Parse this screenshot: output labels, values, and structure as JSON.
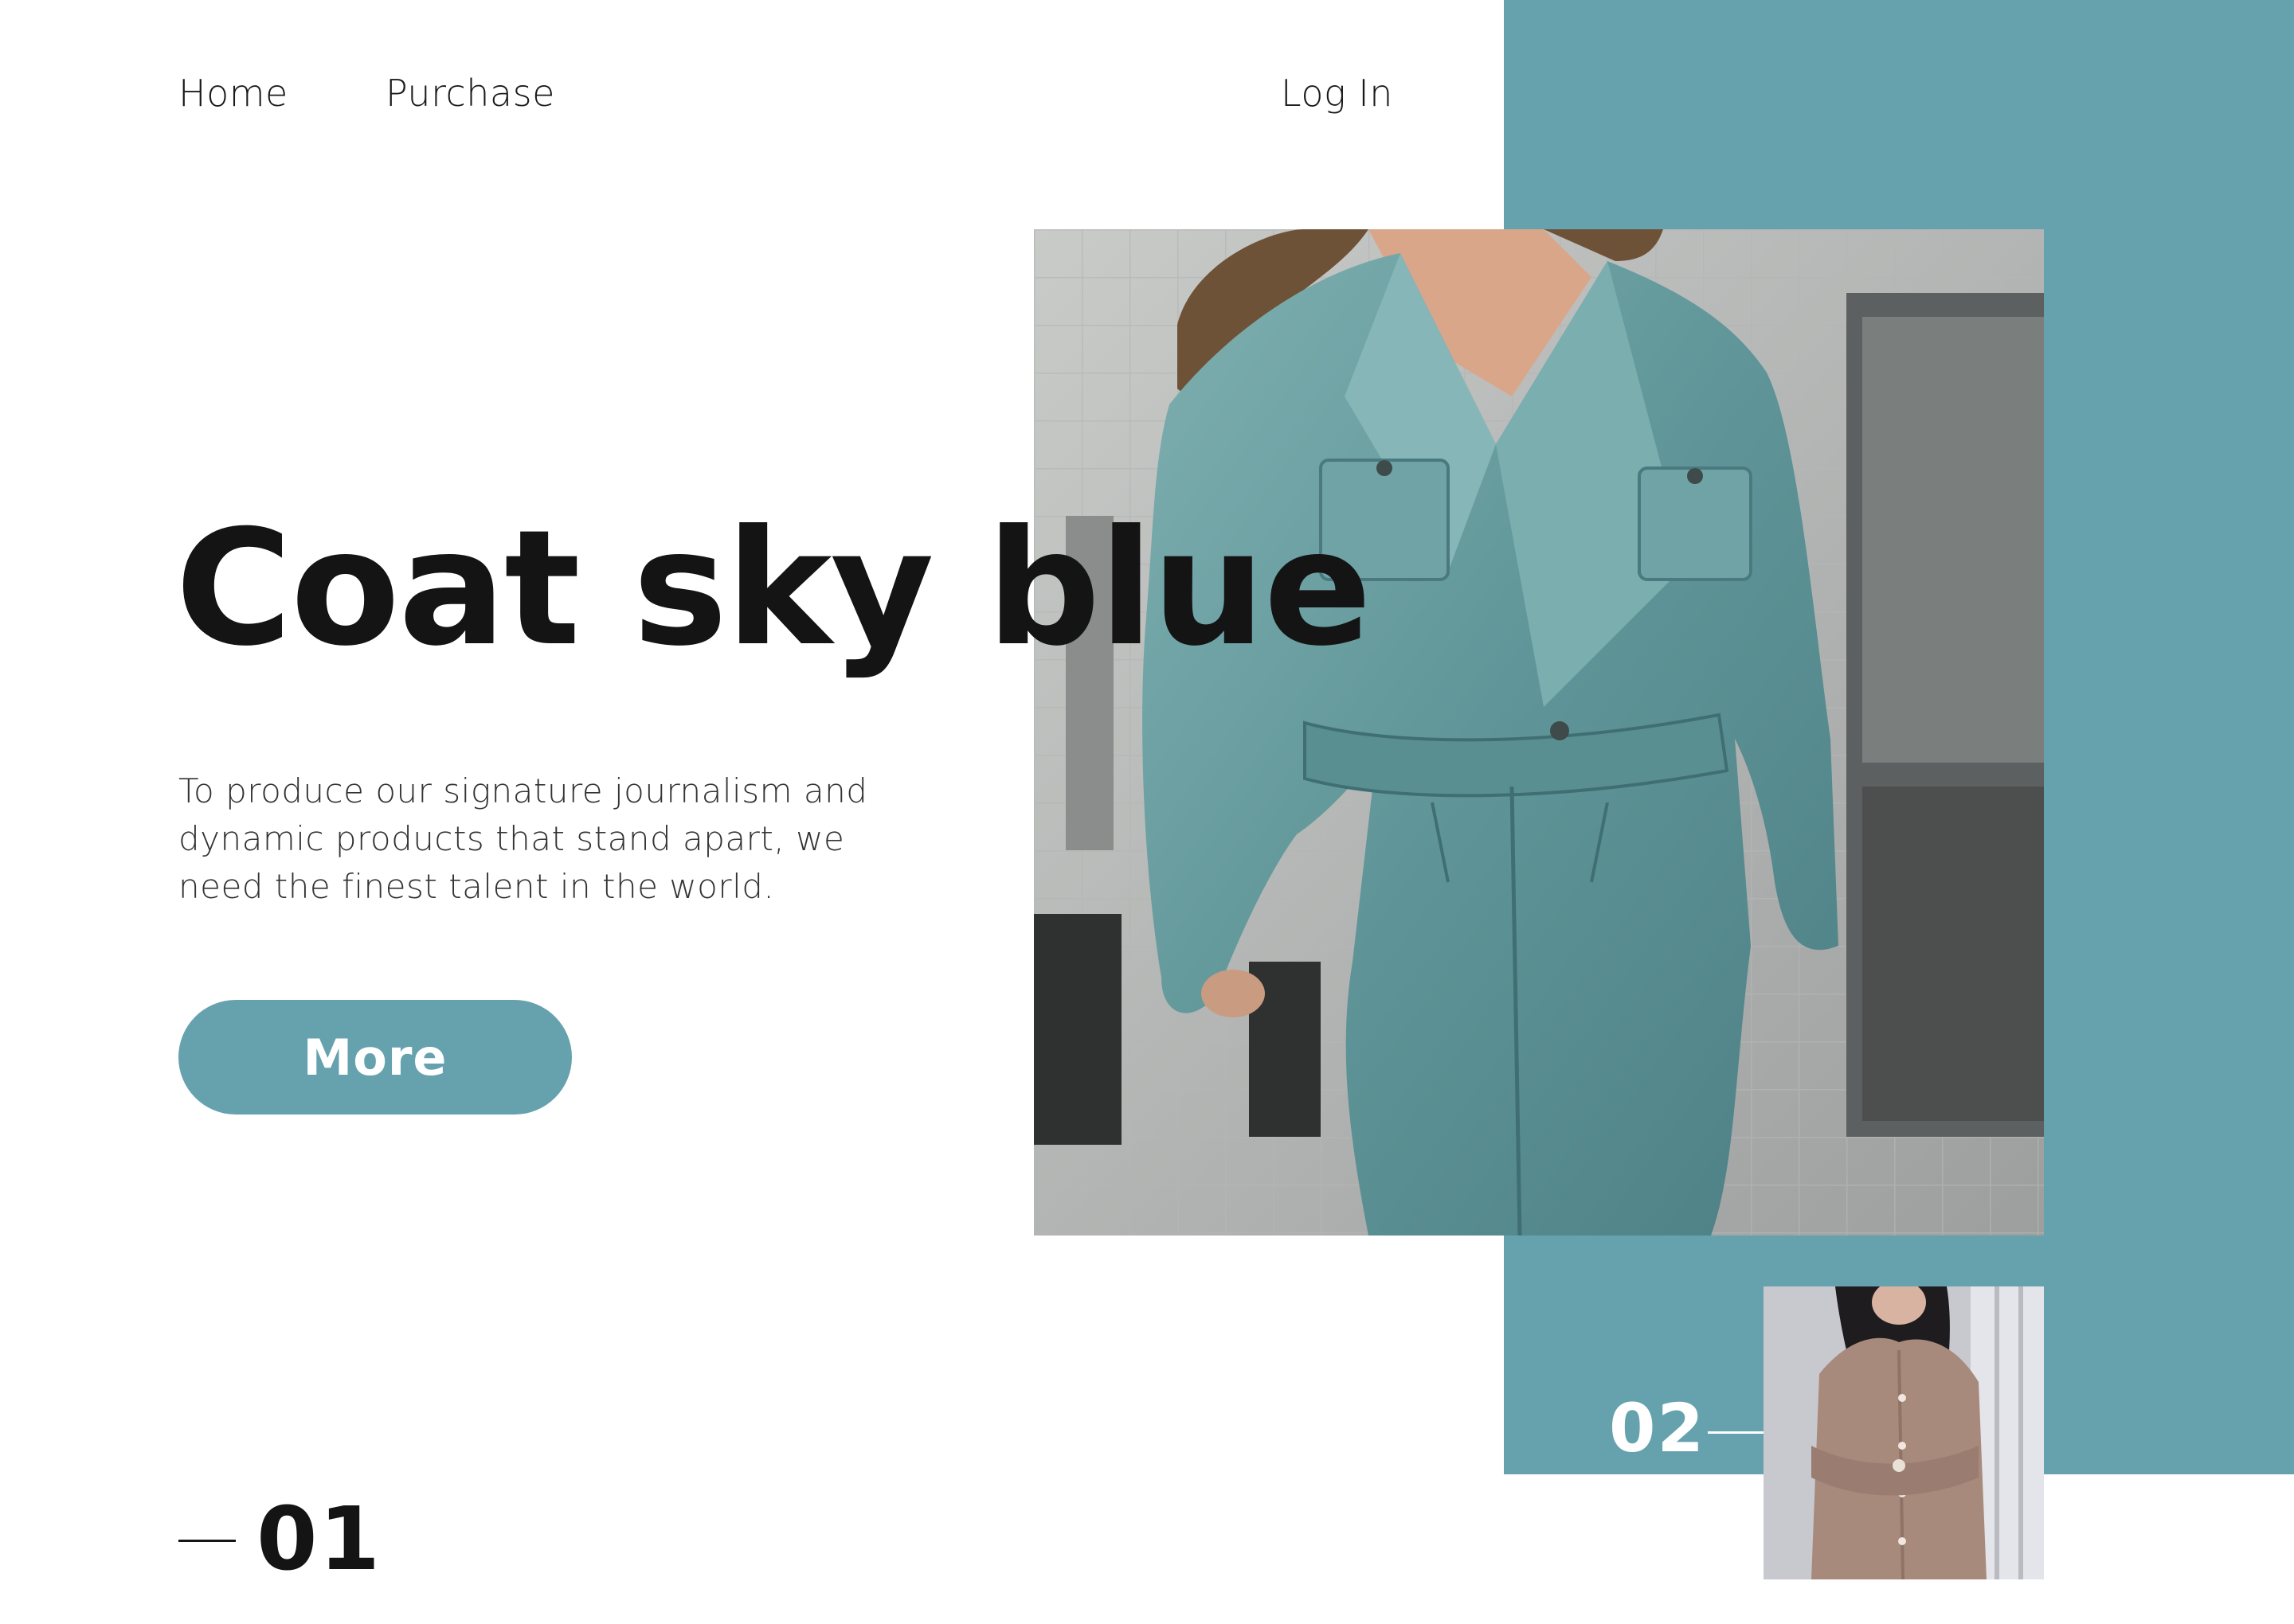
{
  "nav": {
    "home_label": "Home",
    "purchase_label": "Purchase",
    "login_label": "Log In"
  },
  "hero": {
    "title": "Coat sky blue",
    "description": "To produce our signature journalism and dynamic products that stand apart, we need the finest talent in the world.",
    "more_label": "More",
    "photo_alt": "Woman in denim jumpsuit"
  },
  "slides": {
    "current": "01",
    "next": "02",
    "next_thumb_alt": "Woman in taupe dress"
  },
  "colors": {
    "accent": "#66a2ae",
    "text": "#141414",
    "background": "#ffffff"
  }
}
